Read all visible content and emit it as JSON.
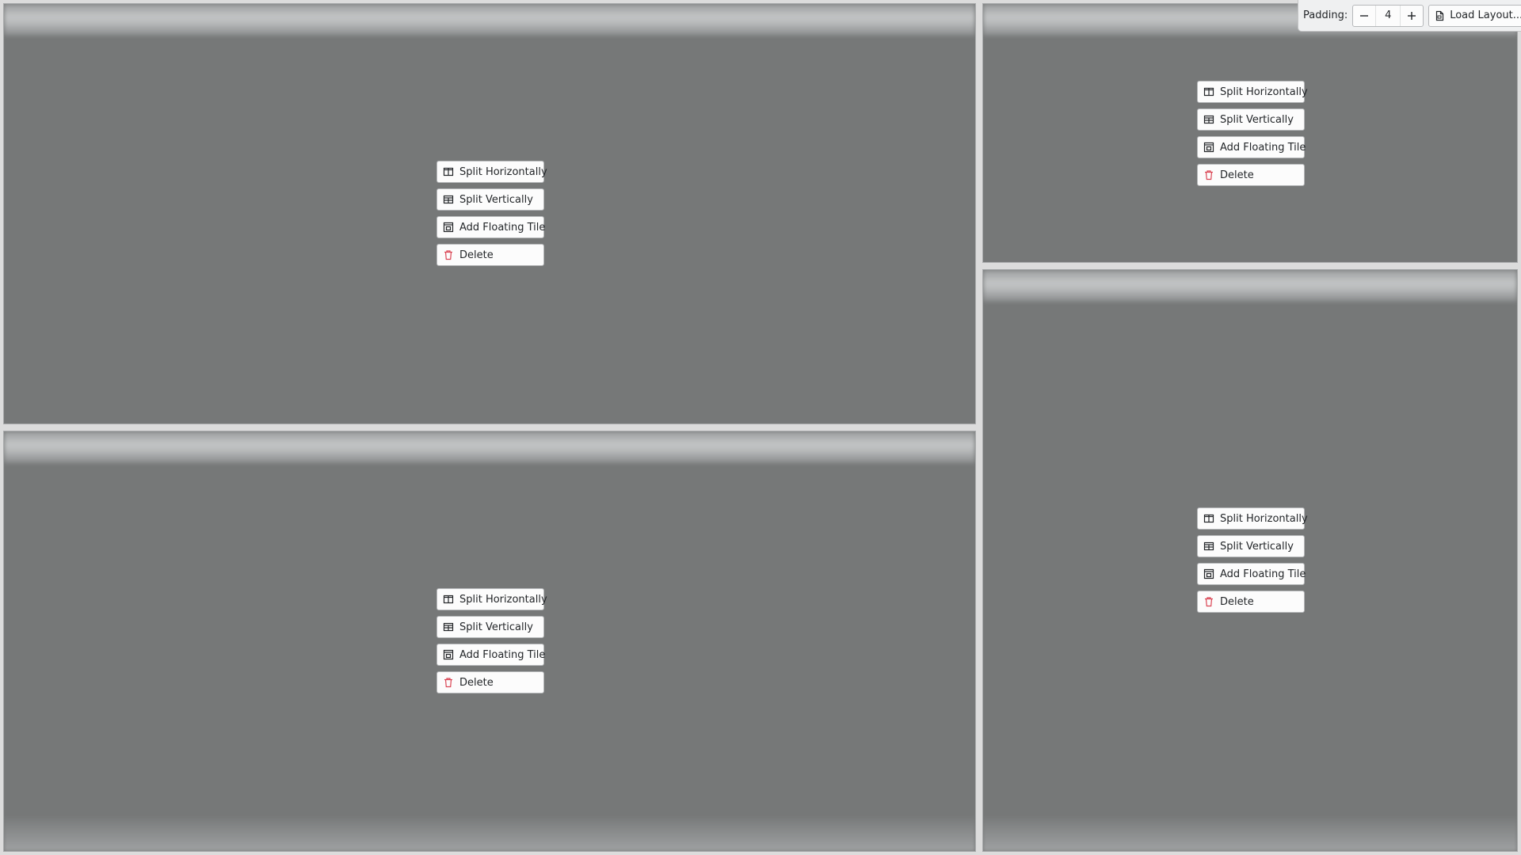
{
  "toolbar": {
    "padding_label": "Padding:",
    "padding_value": "4",
    "decrement_icon": "minus-icon",
    "increment_icon": "plus-icon",
    "load_layout_label": "Load Layout...",
    "load_layout_icon": "document-open-icon"
  },
  "tile_menu": {
    "split_horizontally": "Split Horizontally",
    "split_vertically": "Split Vertically",
    "add_floating_tile": "Add Floating Tile",
    "delete": "Delete"
  },
  "icons": {
    "split_horizontally": "split-horizontal-icon",
    "split_vertically": "split-vertical-icon",
    "add_floating_tile": "floating-tile-icon",
    "delete": "trash-icon"
  },
  "colors": {
    "delete_icon": "#da4453",
    "tile_overlay": "#767878"
  }
}
